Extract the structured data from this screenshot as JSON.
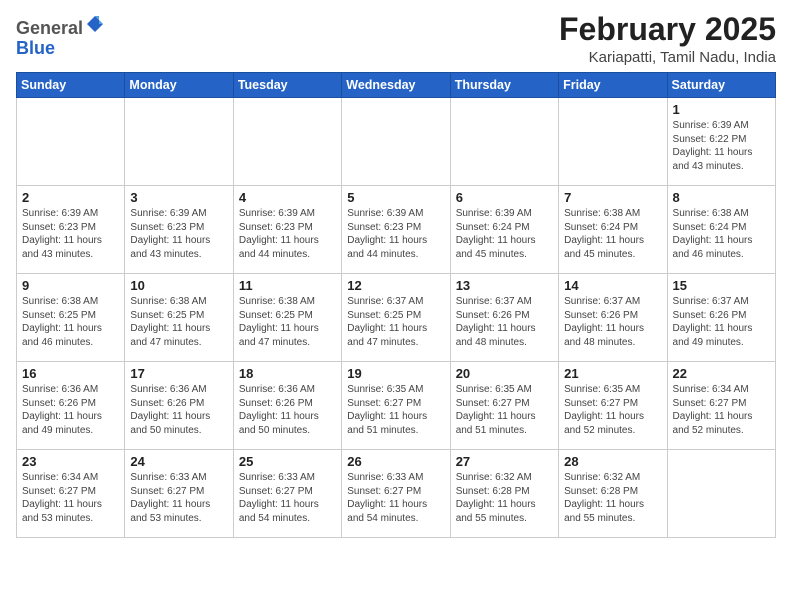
{
  "header": {
    "logo_general": "General",
    "logo_blue": "Blue",
    "month_title": "February 2025",
    "location": "Kariapatti, Tamil Nadu, India"
  },
  "days_of_week": [
    "Sunday",
    "Monday",
    "Tuesday",
    "Wednesday",
    "Thursday",
    "Friday",
    "Saturday"
  ],
  "weeks": [
    [
      {
        "day": "",
        "info": ""
      },
      {
        "day": "",
        "info": ""
      },
      {
        "day": "",
        "info": ""
      },
      {
        "day": "",
        "info": ""
      },
      {
        "day": "",
        "info": ""
      },
      {
        "day": "",
        "info": ""
      },
      {
        "day": "1",
        "info": "Sunrise: 6:39 AM\nSunset: 6:22 PM\nDaylight: 11 hours and 43 minutes."
      }
    ],
    [
      {
        "day": "2",
        "info": "Sunrise: 6:39 AM\nSunset: 6:23 PM\nDaylight: 11 hours and 43 minutes."
      },
      {
        "day": "3",
        "info": "Sunrise: 6:39 AM\nSunset: 6:23 PM\nDaylight: 11 hours and 43 minutes."
      },
      {
        "day": "4",
        "info": "Sunrise: 6:39 AM\nSunset: 6:23 PM\nDaylight: 11 hours and 44 minutes."
      },
      {
        "day": "5",
        "info": "Sunrise: 6:39 AM\nSunset: 6:23 PM\nDaylight: 11 hours and 44 minutes."
      },
      {
        "day": "6",
        "info": "Sunrise: 6:39 AM\nSunset: 6:24 PM\nDaylight: 11 hours and 45 minutes."
      },
      {
        "day": "7",
        "info": "Sunrise: 6:38 AM\nSunset: 6:24 PM\nDaylight: 11 hours and 45 minutes."
      },
      {
        "day": "8",
        "info": "Sunrise: 6:38 AM\nSunset: 6:24 PM\nDaylight: 11 hours and 46 minutes."
      }
    ],
    [
      {
        "day": "9",
        "info": "Sunrise: 6:38 AM\nSunset: 6:25 PM\nDaylight: 11 hours and 46 minutes."
      },
      {
        "day": "10",
        "info": "Sunrise: 6:38 AM\nSunset: 6:25 PM\nDaylight: 11 hours and 47 minutes."
      },
      {
        "day": "11",
        "info": "Sunrise: 6:38 AM\nSunset: 6:25 PM\nDaylight: 11 hours and 47 minutes."
      },
      {
        "day": "12",
        "info": "Sunrise: 6:37 AM\nSunset: 6:25 PM\nDaylight: 11 hours and 47 minutes."
      },
      {
        "day": "13",
        "info": "Sunrise: 6:37 AM\nSunset: 6:26 PM\nDaylight: 11 hours and 48 minutes."
      },
      {
        "day": "14",
        "info": "Sunrise: 6:37 AM\nSunset: 6:26 PM\nDaylight: 11 hours and 48 minutes."
      },
      {
        "day": "15",
        "info": "Sunrise: 6:37 AM\nSunset: 6:26 PM\nDaylight: 11 hours and 49 minutes."
      }
    ],
    [
      {
        "day": "16",
        "info": "Sunrise: 6:36 AM\nSunset: 6:26 PM\nDaylight: 11 hours and 49 minutes."
      },
      {
        "day": "17",
        "info": "Sunrise: 6:36 AM\nSunset: 6:26 PM\nDaylight: 11 hours and 50 minutes."
      },
      {
        "day": "18",
        "info": "Sunrise: 6:36 AM\nSunset: 6:26 PM\nDaylight: 11 hours and 50 minutes."
      },
      {
        "day": "19",
        "info": "Sunrise: 6:35 AM\nSunset: 6:27 PM\nDaylight: 11 hours and 51 minutes."
      },
      {
        "day": "20",
        "info": "Sunrise: 6:35 AM\nSunset: 6:27 PM\nDaylight: 11 hours and 51 minutes."
      },
      {
        "day": "21",
        "info": "Sunrise: 6:35 AM\nSunset: 6:27 PM\nDaylight: 11 hours and 52 minutes."
      },
      {
        "day": "22",
        "info": "Sunrise: 6:34 AM\nSunset: 6:27 PM\nDaylight: 11 hours and 52 minutes."
      }
    ],
    [
      {
        "day": "23",
        "info": "Sunrise: 6:34 AM\nSunset: 6:27 PM\nDaylight: 11 hours and 53 minutes."
      },
      {
        "day": "24",
        "info": "Sunrise: 6:33 AM\nSunset: 6:27 PM\nDaylight: 11 hours and 53 minutes."
      },
      {
        "day": "25",
        "info": "Sunrise: 6:33 AM\nSunset: 6:27 PM\nDaylight: 11 hours and 54 minutes."
      },
      {
        "day": "26",
        "info": "Sunrise: 6:33 AM\nSunset: 6:27 PM\nDaylight: 11 hours and 54 minutes."
      },
      {
        "day": "27",
        "info": "Sunrise: 6:32 AM\nSunset: 6:28 PM\nDaylight: 11 hours and 55 minutes."
      },
      {
        "day": "28",
        "info": "Sunrise: 6:32 AM\nSunset: 6:28 PM\nDaylight: 11 hours and 55 minutes."
      },
      {
        "day": "",
        "info": ""
      }
    ]
  ]
}
